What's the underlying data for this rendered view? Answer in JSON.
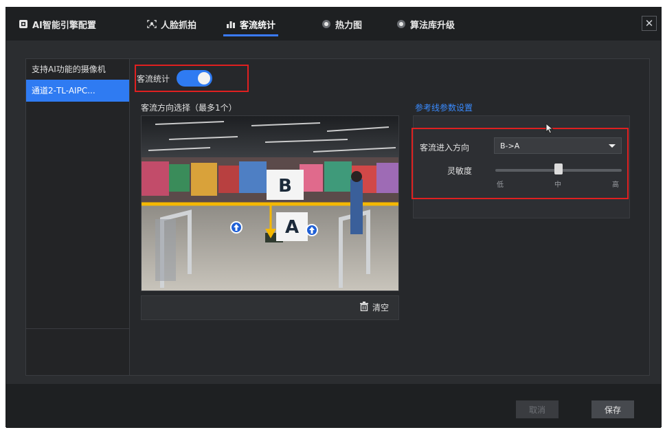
{
  "tabs": [
    {
      "label": "AI智能引擎配置",
      "icon": "chip-icon",
      "active": false
    },
    {
      "label": "人脸抓拍",
      "icon": "face-scan-icon",
      "active": false
    },
    {
      "label": "客流统计",
      "icon": "bar-chart-icon",
      "active": true
    },
    {
      "label": "热力图",
      "icon": "heat-dot-icon",
      "active": false
    },
    {
      "label": "算法库升级",
      "icon": "upgrade-dot-icon",
      "active": false
    }
  ],
  "close_icon": "close-icon",
  "sidebar": {
    "title": "支持AI功能的摄像机",
    "items": [
      {
        "label": "通道2-TL-AIPC...",
        "selected": true
      }
    ]
  },
  "main": {
    "toggle_label": "客流统计",
    "toggle_on": true,
    "direction_title": "客流方向选择（最多1个）",
    "camera": {
      "label_b": "B",
      "label_a": "A"
    },
    "clear_label": "清空",
    "param_title": "参考线参数设置",
    "direction_label": "客流进入方向",
    "direction_value": "B->A",
    "sensitivity_label": "灵敏度",
    "sensitivity_level": 0.5,
    "sensitivity_ticks": [
      "低",
      "中",
      "高"
    ]
  },
  "footer": {
    "cancel_label": "取消",
    "save_label": "保存"
  },
  "colors": {
    "accent": "#2f7bf2",
    "highlight": "#e02020",
    "line": "#f5b800"
  }
}
